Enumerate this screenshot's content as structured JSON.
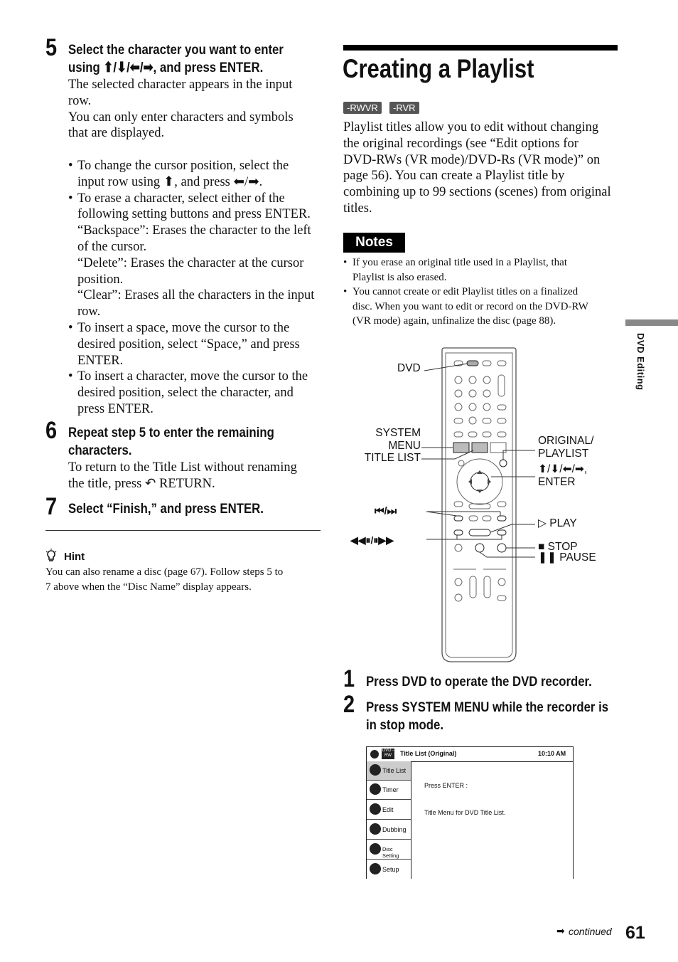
{
  "left": {
    "step5": {
      "num": "5",
      "line1": "Select the character you want to enter",
      "line2": "using ⬆/⬇/⬅/➡, and press ENTER.",
      "p1a": "The selected character appears in the input",
      "p1b": "row.",
      "p2a": "You can only enter characters and symbols",
      "p2b": "that are displayed.",
      "b1": [
        "To change the cursor position, select the",
        "input row using ⬆, and press ⬅/➡."
      ],
      "b2": [
        "To erase a character, select either of the",
        "following setting buttons and press ENTER.",
        "“Backspace”: Erases the character to the left",
        "of the cursor.",
        "“Delete”: Erases the character at the cursor",
        "position.",
        "“Clear”: Erases all the characters in the input",
        "row."
      ],
      "b3": [
        "To insert a space, move the cursor to the",
        "desired position, select “Space,” and press",
        "ENTER."
      ],
      "b4": [
        "To insert a character, move the cursor to the",
        "desired position, select the character, and",
        "press ENTER."
      ]
    },
    "step6": {
      "num": "6",
      "line1": "Repeat step 5 to enter the remaining",
      "line2": "characters.",
      "p1": "To return to the Title List without renaming",
      "p2": "the title, press ↶ RETURN."
    },
    "step7": {
      "num": "7",
      "line1": "Select “Finish,” and press ENTER."
    },
    "hint": {
      "label": "Hint",
      "l1": "You can also rename a disc (page 67). Follow steps 5 to",
      "l2": "7 above when the “Disc Name” display appears."
    }
  },
  "right": {
    "title": "Creating a Playlist",
    "badges": [
      "-RWVR",
      "-RVR"
    ],
    "intro": [
      "Playlist titles allow you to edit without changing",
      "the original recordings (see “Edit options for",
      "DVD-RWs (VR mode)/DVD-Rs (VR mode)” on",
      "page 56). You can create a Playlist title by",
      "combining up to 99 sections (scenes) from original",
      "titles."
    ],
    "notes_label": "Notes",
    "notes": [
      [
        "If you erase an original title used in a Playlist, that",
        "Playlist is also erased."
      ],
      [
        "You cannot create or edit Playlist titles on a finalized",
        "disc. When you want to edit or record on the DVD-RW",
        "(VR mode) again, unfinalize the disc (page 88)."
      ]
    ],
    "remote_labels": {
      "dvd": "DVD",
      "system": "SYSTEM",
      "menu": "MENU",
      "title_list": "TITLE LIST",
      "skip": "⏮/⏭",
      "scan": "◀◀⏸/⏸▶▶",
      "original": "ORIGINAL/",
      "playlist": "PLAYLIST",
      "arrows": "⬆/⬇/⬅/➡,",
      "enter": "ENTER",
      "play": "▷ PLAY",
      "stop": "■ STOP",
      "pause": "❚❚ PAUSE"
    },
    "step1": {
      "num": "1",
      "text": "Press DVD to operate the DVD recorder."
    },
    "step2": {
      "num": "2",
      "line1": "Press SYSTEM MENU while the recorder is",
      "line2": "in stop mode."
    },
    "screen": {
      "header": "Title List (Original)",
      "time": "10:10 AM",
      "disc_icon": "DVD -RW",
      "menu": [
        "Title List",
        "Timer",
        "Edit",
        "Dubbing",
        "Disc Setting",
        "Setup"
      ],
      "line1": "Press ENTER :",
      "line2": "Title Menu for DVD Title List."
    }
  },
  "side_tab": "DVD Editing",
  "footer": {
    "continued": "continued",
    "page": "61"
  }
}
